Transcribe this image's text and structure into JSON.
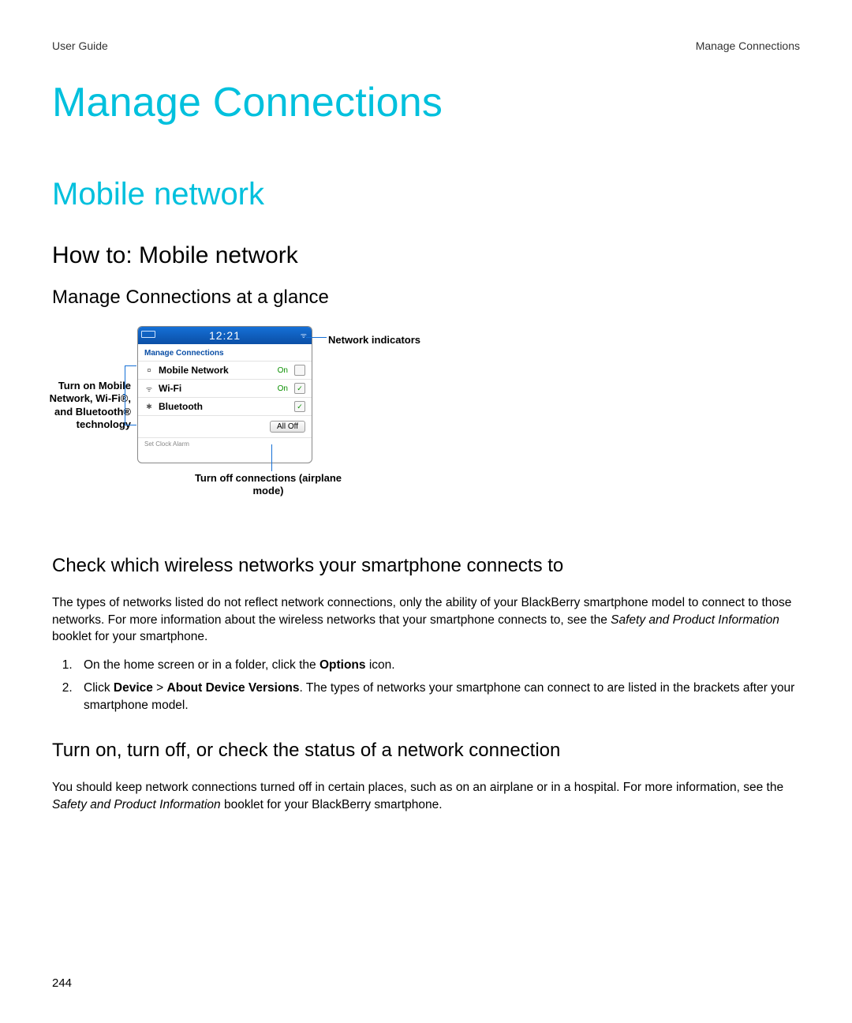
{
  "header": {
    "left": "User Guide",
    "right": "Manage Connections"
  },
  "h1": "Manage Connections",
  "h2": "Mobile network",
  "h3": "How to: Mobile network",
  "h4a": "Manage Connections at a glance",
  "diagram": {
    "time": "12:21",
    "panel_title": "Manage Connections",
    "rows": {
      "mobile": {
        "label": "Mobile Network",
        "state": "On",
        "checked": false
      },
      "wifi": {
        "label": "Wi-Fi",
        "state": "On",
        "checked": true
      },
      "bt": {
        "label": "Bluetooth",
        "state": "",
        "checked": true
      }
    },
    "alloff": "All Off",
    "cutoff_row": "Set Clock Alarm",
    "callout_left": "Turn on Mobile Network, Wi-Fi®, and Bluetooth® technology",
    "callout_topright": "Network indicators",
    "callout_bottom": "Turn off connections (airplane mode)"
  },
  "h4b": "Check which wireless networks your smartphone connects to",
  "para_b_1a": "The types of networks listed do not reflect network connections, only the ability of your BlackBerry smartphone model to connect to those networks. For more information about the wireless networks that your smartphone connects to, see the ",
  "para_b_1_em": "Safety and Product Information",
  "para_b_1b": " booklet for your smartphone.",
  "step1_a": "On the home screen or in a folder, click the ",
  "step1_b": "Options",
  "step1_c": " icon.",
  "step2_a": "Click ",
  "step2_b": "Device",
  "step2_c": " > ",
  "step2_d": "About Device Versions",
  "step2_e": ". The types of networks your smartphone can connect to are listed in the brackets after your smartphone model.",
  "h4c": "Turn on, turn off, or check the status of a network connection",
  "para_c_a": "You should keep network connections turned off in certain places, such as on an airplane or in a hospital. For more information, see the ",
  "para_c_em": "Safety and Product Information",
  "para_c_b": " booklet for your BlackBerry smartphone.",
  "page_number": "244"
}
